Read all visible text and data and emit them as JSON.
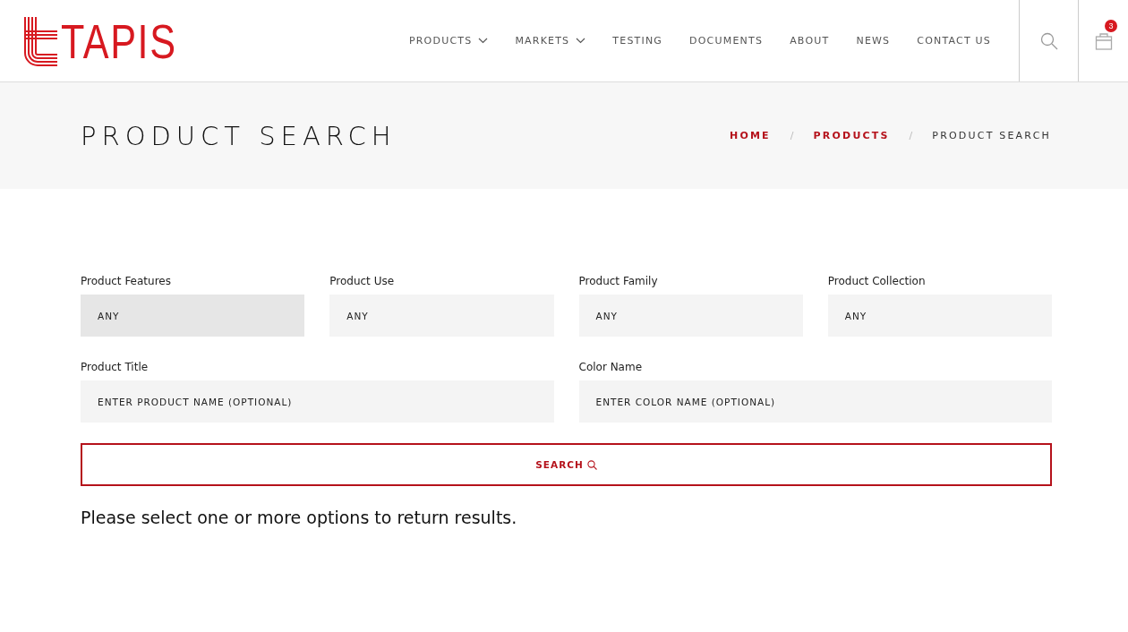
{
  "logo": {
    "text": "TAPIS"
  },
  "nav": [
    {
      "label": "PRODUCTS",
      "dropdown": true
    },
    {
      "label": "MARKETS",
      "dropdown": true
    },
    {
      "label": "TESTING",
      "dropdown": false
    },
    {
      "label": "DOCUMENTS",
      "dropdown": false
    },
    {
      "label": "ABOUT",
      "dropdown": false
    },
    {
      "label": "NEWS",
      "dropdown": false
    },
    {
      "label": "CONTACT US",
      "dropdown": false
    }
  ],
  "cart": {
    "count": "3"
  },
  "page_title": "PRODUCT SEARCH",
  "breadcrumb": [
    {
      "label": "HOME",
      "link": true
    },
    {
      "separator": "/",
      "label": "PRODUCTS",
      "link": true
    },
    {
      "separator": "/",
      "label": "PRODUCT SEARCH",
      "link": false
    }
  ],
  "selects": [
    {
      "label": "Product Features",
      "value": "ANY",
      "focused": true
    },
    {
      "label": "Product Use",
      "value": "ANY",
      "focused": false
    },
    {
      "label": "Product Family",
      "value": "ANY",
      "focused": false
    },
    {
      "label": "Product Collection",
      "value": "ANY",
      "focused": false
    }
  ],
  "text_fields": [
    {
      "label": "Product Title",
      "placeholder": "ENTER PRODUCT NAME (OPTIONAL)"
    },
    {
      "label": "Color Name",
      "placeholder": "ENTER COLOR NAME (OPTIONAL)"
    }
  ],
  "search_button": "SEARCH",
  "message": "Please select one or more options to return results."
}
